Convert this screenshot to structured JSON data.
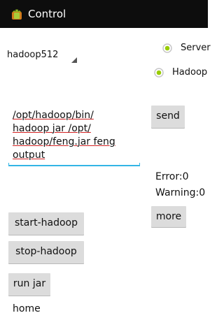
{
  "header": {
    "title": "Control",
    "icon": "android-icon"
  },
  "spinner": {
    "value": "hadoop512"
  },
  "radios": [
    {
      "label": "Server",
      "checked": true
    },
    {
      "label": "Hadoop",
      "checked": true
    }
  ],
  "command": {
    "text": "/opt/hadoop/bin/ hadoop jar /opt/ hadoop/feng.jar feng output"
  },
  "buttons": {
    "send": "send",
    "more": "more",
    "start": "start-hadoop",
    "stop": "stop-hadoop",
    "run": "run jar"
  },
  "status": {
    "error": "Error:0",
    "warning": "Warning:0"
  },
  "footer": {
    "text": "home"
  },
  "colors": {
    "accent": "#33b5e5",
    "radio": "#99cc00",
    "button": "#dcdcdc",
    "titlebar": "#0d0d0d"
  }
}
